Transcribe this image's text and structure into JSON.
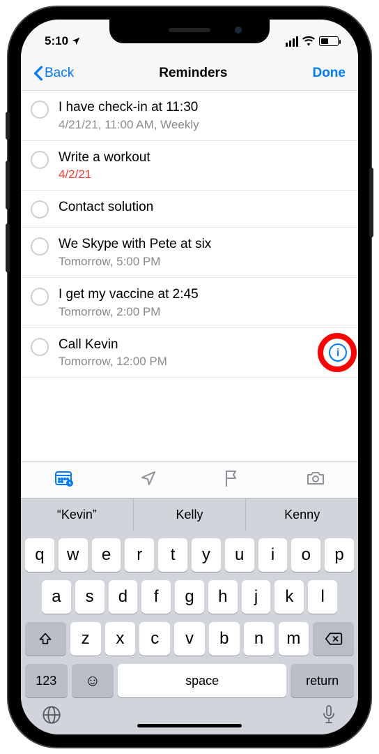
{
  "status": {
    "time": "5:10"
  },
  "nav": {
    "back": "Back",
    "title": "Reminders",
    "done": "Done"
  },
  "reminders": [
    {
      "title": "I have check-in at 11:30",
      "sub": "4/21/21, 11:00 AM, Weekly",
      "overdue": false,
      "info": false
    },
    {
      "title": "Write a workout",
      "sub": "4/2/21",
      "overdue": true,
      "info": false
    },
    {
      "title": "Contact solution",
      "sub": "",
      "overdue": false,
      "info": false
    },
    {
      "title": "We Skype with Pete at six",
      "sub": "Tomorrow, 5:00 PM",
      "overdue": false,
      "info": false
    },
    {
      "title": "I get my vaccine at 2:45",
      "sub": "Tomorrow, 2:00 PM",
      "overdue": false,
      "info": false
    },
    {
      "title": "Call Kevin",
      "sub": "Tomorrow, 12:00 PM",
      "overdue": false,
      "info": true,
      "highlight": true
    }
  ],
  "suggestions": [
    "“Kevin”",
    "Kelly",
    "Kenny"
  ],
  "keyboard": {
    "row1": [
      "q",
      "w",
      "e",
      "r",
      "t",
      "y",
      "u",
      "i",
      "o",
      "p"
    ],
    "row2": [
      "a",
      "s",
      "d",
      "f",
      "g",
      "h",
      "j",
      "k",
      "l"
    ],
    "row3": [
      "z",
      "x",
      "c",
      "v",
      "b",
      "n",
      "m"
    ],
    "numKey": "123",
    "space": "space",
    "return": "return"
  }
}
